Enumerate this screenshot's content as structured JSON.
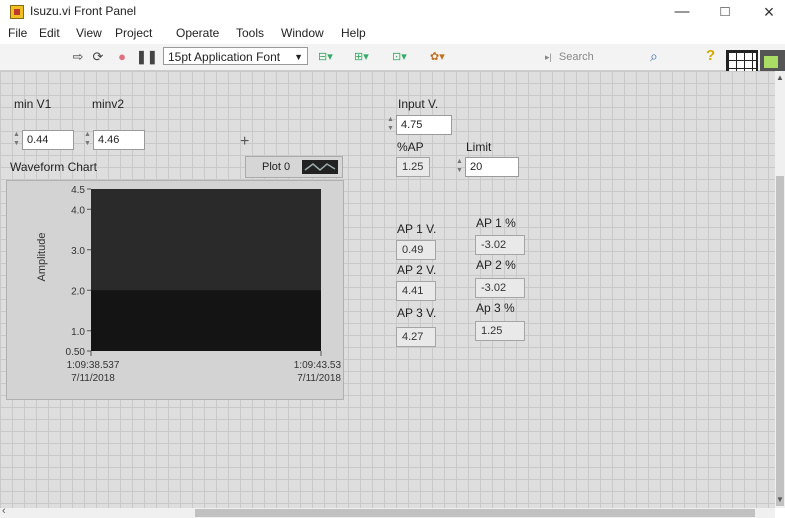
{
  "window": {
    "title": "Isuzu.vi Front Panel",
    "minimize": "—",
    "maximize": "□",
    "close": "×"
  },
  "menu": [
    "File",
    "Edit",
    "View",
    "Project",
    "Operate",
    "Tools",
    "Window",
    "Help"
  ],
  "toolbar": {
    "font": "15pt Application Font",
    "search_placeholder": "Search",
    "help_icon": "?"
  },
  "controls": {
    "min_v1": {
      "label": "min V1",
      "value": "0.44"
    },
    "min_v2": {
      "label": "minv2",
      "value": "4.46"
    },
    "input_v": {
      "label": "Input V.",
      "value": "4.75"
    },
    "pct_ap": {
      "label": "%AP",
      "value": "1.25"
    },
    "limit": {
      "label": "Limit",
      "value": "20"
    },
    "ap1_v": {
      "label": "AP 1 V.",
      "value": "0.49"
    },
    "ap2_v": {
      "label": "AP 2 V.",
      "value": "4.41"
    },
    "ap3_v": {
      "label": "AP 3 V.",
      "value": "4.27"
    },
    "ap1_pct": {
      "label": "AP 1 %",
      "value": "-3.02"
    },
    "ap2_pct": {
      "label": "AP 2 %",
      "value": "-3.02"
    },
    "ap3_pct": {
      "label": "Ap 3 %",
      "value": "1.25"
    }
  },
  "chart_data": {
    "type": "area",
    "title": "Waveform Chart",
    "ylabel": "Amplitude",
    "legend": "Plot 0",
    "ylim": [
      0.5,
      4.5
    ],
    "y_ticks": [
      "4.5",
      "4.0",
      "3.0",
      "2.0",
      "1.0",
      "0.50"
    ],
    "x_ticks": [
      {
        "time": "1:09:38.537",
        "date": "7/11/2018"
      },
      {
        "time": "1:09:43.53",
        "date": "7/11/2018"
      }
    ],
    "series": [
      {
        "values": [
          2.0,
          2.0
        ]
      }
    ],
    "colors": {
      "background": "#2a2a2a",
      "trace": "#141414"
    }
  }
}
